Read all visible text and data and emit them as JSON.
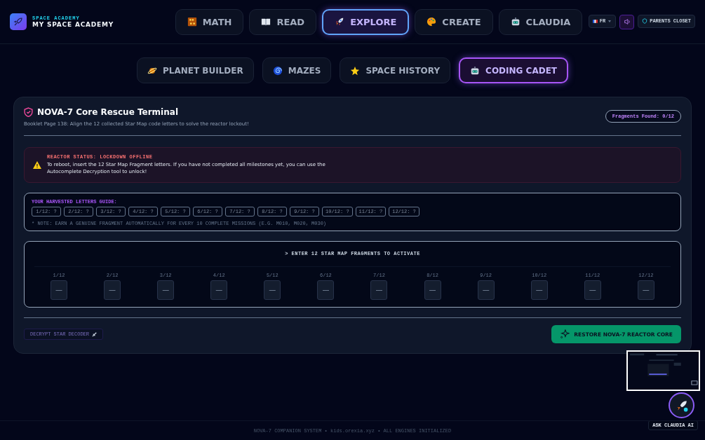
{
  "brand": {
    "subtitle": "SPACE ACADEMY",
    "title": "MY SPACE ACADEMY"
  },
  "main_tabs": [
    {
      "label": "MATH",
      "selected": false
    },
    {
      "label": "READ",
      "selected": false
    },
    {
      "label": "EXPLORE",
      "selected": true
    },
    {
      "label": "CREATE",
      "selected": false
    },
    {
      "label": "CLAUDIA",
      "selected": false
    }
  ],
  "header_actions": {
    "language": "FR",
    "parents_button": "PARENTS CLOSET"
  },
  "sub_tabs": [
    {
      "label": "PLANET BUILDER",
      "selected": false
    },
    {
      "label": "MAZES",
      "selected": false
    },
    {
      "label": "SPACE HISTORY",
      "selected": false
    },
    {
      "label": "CODING CADET",
      "selected": true
    }
  ],
  "terminal": {
    "title": "NOVA-7 Core Rescue Terminal",
    "subtitle": "Booklet Page 138: Align the 12 collected Star Map code letters to solve the reactor lockout!",
    "badge": "Fragments Found: 0/12",
    "alert": {
      "heading": "REACTOR STATUS: LOCKDOWN OFFLINE",
      "text": "To reboot, insert the 12 Star Map Fragment letters. If you have not completed all milestones yet, you can use the Autocomplete Decryption tool to unlock!"
    },
    "guide": {
      "heading": "YOUR HARVESTED LETTERS GUIDE:",
      "chips": [
        "1/12: ?",
        "2/12: ?",
        "3/12: ?",
        "4/12: ?",
        "5/12: ?",
        "6/12: ?",
        "7/12: ?",
        "8/12: ?",
        "9/12: ?",
        "10/12: ?",
        "11/12: ?",
        "12/12: ?"
      ],
      "note": "* NOTE: EARN A GENUINE FRAGMENT AUTOMATICALLY FOR EVERY 10 COMPLETE MISSIONS (E.G. M010, M020, M030)"
    },
    "entry": {
      "heading": "> ENTER 12 STAR MAP FRAGMENTS TO ACTIVATE",
      "slots": [
        {
          "label": "1/12",
          "placeholder": "—"
        },
        {
          "label": "2/12",
          "placeholder": "—"
        },
        {
          "label": "3/12",
          "placeholder": "—"
        },
        {
          "label": "4/12",
          "placeholder": "—"
        },
        {
          "label": "5/12",
          "placeholder": "—"
        },
        {
          "label": "6/12",
          "placeholder": "—"
        },
        {
          "label": "7/12",
          "placeholder": "—"
        },
        {
          "label": "8/12",
          "placeholder": "—"
        },
        {
          "label": "9/12",
          "placeholder": "—"
        },
        {
          "label": "10/12",
          "placeholder": "—"
        },
        {
          "label": "11/12",
          "placeholder": "—"
        },
        {
          "label": "12/12",
          "placeholder": "—"
        }
      ]
    },
    "decrypt_button": "DECRYPT STAR DECODER",
    "restore_button": "RESTORE NOVA-7 REACTOR CORE"
  },
  "assistant": {
    "label": "ASK CLAUDIA AI"
  },
  "footer": "NOVA-7 COMPANION SYSTEM • kids.orexia.xyz • ALL ENGINES INITIALIZED"
}
